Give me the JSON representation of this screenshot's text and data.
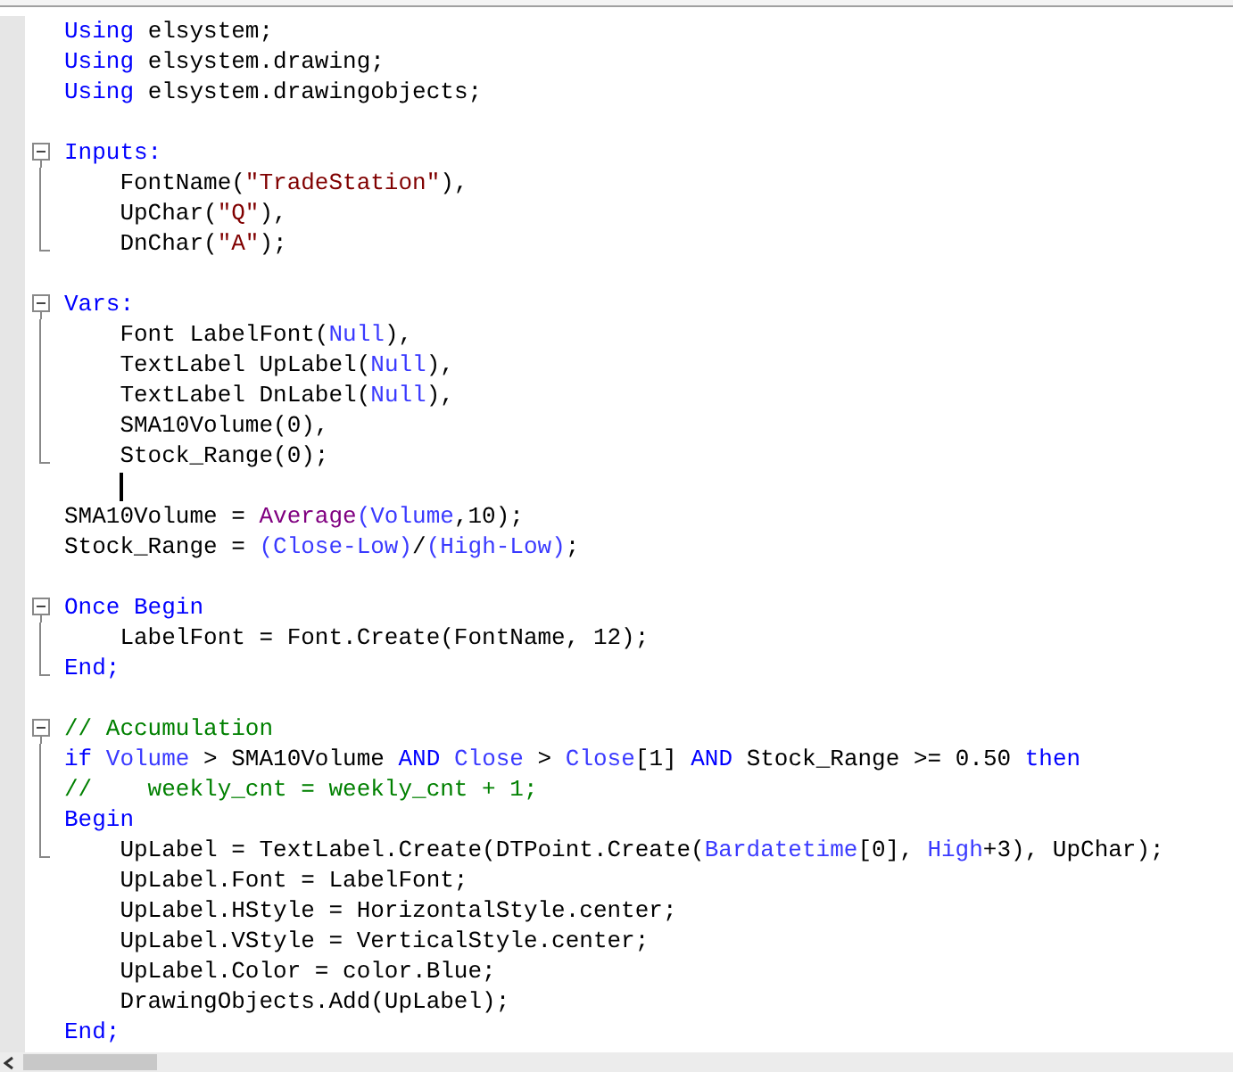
{
  "editor": {
    "lines": [
      {
        "tokens": [
          {
            "kind": "kw",
            "text": "Using"
          },
          {
            "kind": "tx",
            "text": " elsystem;"
          }
        ]
      },
      {
        "tokens": [
          {
            "kind": "kw",
            "text": "Using"
          },
          {
            "kind": "tx",
            "text": " elsystem.drawing;"
          }
        ]
      },
      {
        "tokens": [
          {
            "kind": "kw",
            "text": "Using"
          },
          {
            "kind": "tx",
            "text": " elsystem.drawingobjects;"
          }
        ]
      },
      {
        "kind": "blank"
      },
      {
        "kind": "fold-start",
        "tokens": [
          {
            "kind": "kw",
            "text": "Inputs:"
          }
        ]
      },
      {
        "kind": "fold-body",
        "tokens": [
          {
            "kind": "tx",
            "text": "    FontName("
          },
          {
            "kind": "str",
            "text": "\"TradeStation\""
          },
          {
            "kind": "tx",
            "text": "),"
          }
        ]
      },
      {
        "kind": "fold-body",
        "tokens": [
          {
            "kind": "tx",
            "text": "    UpChar("
          },
          {
            "kind": "str",
            "text": "\"Q\""
          },
          {
            "kind": "tx",
            "text": "),"
          }
        ]
      },
      {
        "kind": "fold-end",
        "tokens": [
          {
            "kind": "tx",
            "text": "    DnChar("
          },
          {
            "kind": "str",
            "text": "\"A\""
          },
          {
            "kind": "tx",
            "text": ");"
          }
        ]
      },
      {
        "kind": "blank"
      },
      {
        "kind": "fold-start",
        "tokens": [
          {
            "kind": "kw",
            "text": "Vars:"
          }
        ]
      },
      {
        "kind": "fold-body",
        "tokens": [
          {
            "kind": "tx",
            "text": "    Font LabelFont("
          },
          {
            "kind": "id",
            "text": "Null"
          },
          {
            "kind": "tx",
            "text": "),"
          }
        ]
      },
      {
        "kind": "fold-body",
        "tokens": [
          {
            "kind": "tx",
            "text": "    TextLabel UpLabel("
          },
          {
            "kind": "id",
            "text": "Null"
          },
          {
            "kind": "tx",
            "text": "),"
          }
        ]
      },
      {
        "kind": "fold-body",
        "tokens": [
          {
            "kind": "tx",
            "text": "    TextLabel DnLabel("
          },
          {
            "kind": "id",
            "text": "Null"
          },
          {
            "kind": "tx",
            "text": "),"
          }
        ]
      },
      {
        "kind": "fold-body",
        "tokens": [
          {
            "kind": "tx",
            "text": "    SMA10Volume(0),"
          }
        ]
      },
      {
        "kind": "fold-end",
        "tokens": [
          {
            "kind": "tx",
            "text": "    Stock_Range(0);"
          }
        ]
      },
      {
        "caret": true
      },
      {
        "tokens": [
          {
            "kind": "tx",
            "text": "SMA10Volume = "
          },
          {
            "kind": "fn",
            "text": "Average"
          },
          {
            "kind": "id",
            "text": "(Volume"
          },
          {
            "kind": "tx",
            "text": ",10);"
          }
        ]
      },
      {
        "tokens": [
          {
            "kind": "tx",
            "text": "Stock_Range = "
          },
          {
            "kind": "id",
            "text": "(Close-Low)"
          },
          {
            "kind": "tx",
            "text": "/"
          },
          {
            "kind": "id",
            "text": "(High-Low)"
          },
          {
            "kind": "tx",
            "text": ";"
          }
        ]
      },
      {
        "kind": "blank"
      },
      {
        "kind": "fold-start",
        "tokens": [
          {
            "kind": "kw",
            "text": "Once Begin"
          }
        ]
      },
      {
        "kind": "fold-body",
        "tokens": [
          {
            "kind": "tx",
            "text": "    LabelFont = Font.Create(FontName, 12);"
          }
        ]
      },
      {
        "kind": "fold-end",
        "tokens": [
          {
            "kind": "kw",
            "text": "End;"
          }
        ]
      },
      {
        "kind": "blank"
      },
      {
        "kind": "fold-start",
        "tokens": [
          {
            "kind": "cm",
            "text": "// Accumulation"
          }
        ]
      },
      {
        "kind": "fold-body",
        "tokens": [
          {
            "kind": "kw",
            "text": "if "
          },
          {
            "kind": "id",
            "text": "Volume"
          },
          {
            "kind": "tx",
            "text": " > SMA10Volume "
          },
          {
            "kind": "kw",
            "text": "AND "
          },
          {
            "kind": "id",
            "text": "Close"
          },
          {
            "kind": "tx",
            "text": " > "
          },
          {
            "kind": "id",
            "text": "Close"
          },
          {
            "kind": "tx",
            "text": "[1] "
          },
          {
            "kind": "kw",
            "text": "AND"
          },
          {
            "kind": "tx",
            "text": " Stock_Range >= 0.50 "
          },
          {
            "kind": "kw",
            "text": "then"
          }
        ]
      },
      {
        "kind": "fold-body",
        "tokens": [
          {
            "kind": "cm",
            "text": "//    weekly_cnt = weekly_cnt + 1;"
          }
        ]
      },
      {
        "kind": "fold-body",
        "tokens": [
          {
            "kind": "kw",
            "text": "Begin"
          }
        ]
      },
      {
        "kind": "fold-end",
        "tokens": [
          {
            "kind": "tx",
            "text": "    UpLabel = TextLabel.Create(DTPoint.Create("
          },
          {
            "kind": "id",
            "text": "Bardatetime"
          },
          {
            "kind": "tx",
            "text": "[0], "
          },
          {
            "kind": "id",
            "text": "High"
          },
          {
            "kind": "tx",
            "text": "+3), UpChar);"
          }
        ]
      },
      {
        "tokens": [
          {
            "kind": "tx",
            "text": "    UpLabel.Font = LabelFont;"
          }
        ]
      },
      {
        "tokens": [
          {
            "kind": "tx",
            "text": "    UpLabel.HStyle = HorizontalStyle.center;"
          }
        ]
      },
      {
        "tokens": [
          {
            "kind": "tx",
            "text": "    UpLabel.VStyle = VerticalStyle.center;"
          }
        ]
      },
      {
        "tokens": [
          {
            "kind": "tx",
            "text": "    UpLabel.Color = color.Blue;"
          }
        ]
      },
      {
        "tokens": [
          {
            "kind": "tx",
            "text": "    DrawingObjects.Add(UpLabel);"
          }
        ]
      },
      {
        "tokens": [
          {
            "kind": "kw",
            "text": "End;"
          }
        ]
      }
    ]
  }
}
